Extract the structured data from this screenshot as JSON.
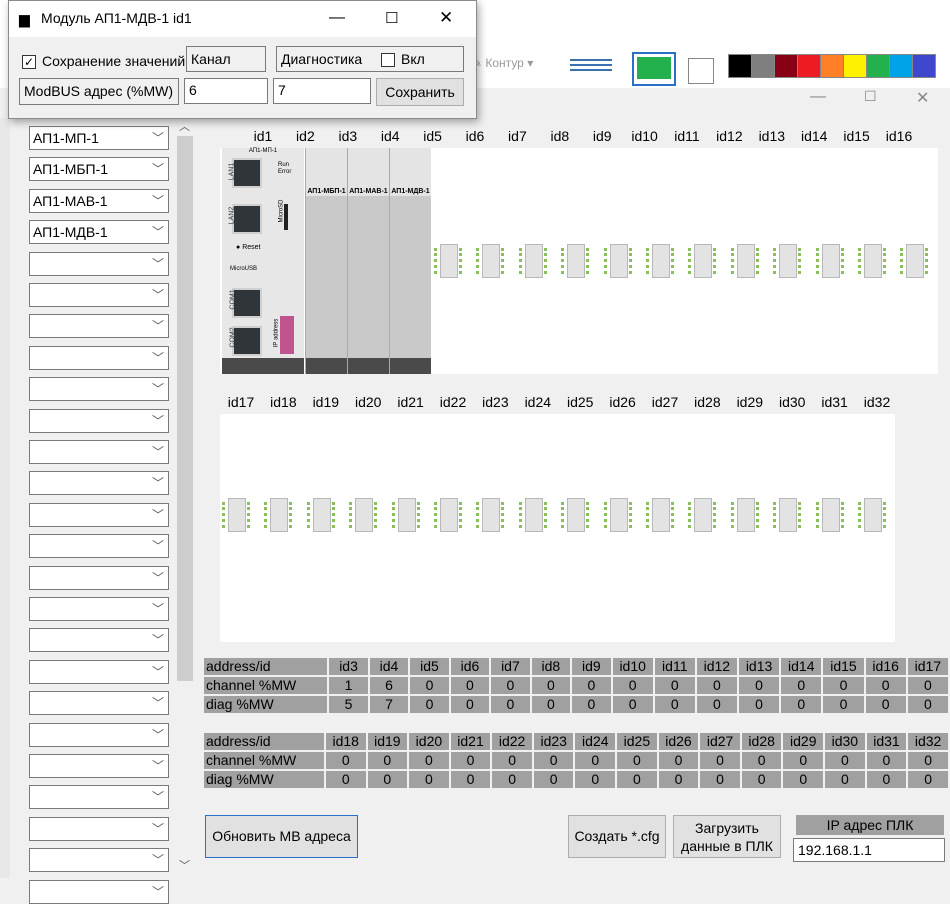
{
  "dialog": {
    "title": "Модуль АП1-МДВ-1 id1",
    "save_values_label": "Сохранение значений",
    "save_values_checked": true,
    "channel_label": "Канал",
    "diag_label": "Диагностика",
    "enable_label": "Вкл",
    "enable_checked": false,
    "modbus_label": "ModBUS адрес (%MW)",
    "channel_value": "6",
    "diag_value": "7",
    "save_button": "Сохранить"
  },
  "toolbar": {
    "contour_label": "Контур",
    "colors": [
      "#000000",
      "#7f7f7f",
      "#880015",
      "#ed1c24",
      "#ff7f27",
      "#fff200",
      "#22b14c",
      "#00a2e8",
      "#3f48cc"
    ]
  },
  "modules": [
    "АП1-МП-1",
    "АП1-МБП-1",
    "АП1-МАВ-1",
    "АП1-МДВ-1",
    "",
    "",
    "",
    "",
    "",
    "",
    "",
    "",
    "",
    "",
    "",
    "",
    "",
    "",
    "",
    "",
    "",
    "",
    "",
    "",
    ""
  ],
  "rack1_ids": [
    "id1",
    "id2",
    "id3",
    "id4",
    "id5",
    "id6",
    "id7",
    "id8",
    "id9",
    "id10",
    "id11",
    "id12",
    "id13",
    "id14",
    "id15",
    "id16"
  ],
  "rack2_ids": [
    "id17",
    "id18",
    "id19",
    "id20",
    "id21",
    "id22",
    "id23",
    "id24",
    "id25",
    "id26",
    "id27",
    "id28",
    "id29",
    "id30",
    "id31",
    "id32"
  ],
  "rack_labels": {
    "mp_top": "АП1-МП-1",
    "lan1": "LAN1",
    "lan2": "LAN2",
    "reset": "Reset",
    "microusb": "MicroUSB",
    "microsd": "MicroSD",
    "com1": "COM1",
    "com2": "COM2",
    "ip": "IP address",
    "run": "Run",
    "error": "Error",
    "mod2": "АП1-МБП-1",
    "mod3": "АП1-МАВ-1",
    "mod4": "АП1-МДВ-1"
  },
  "table1": {
    "header": [
      "address/id",
      "id3",
      "id4",
      "id5",
      "id6",
      "id7",
      "id8",
      "id9",
      "id10",
      "id11",
      "id12",
      "id13",
      "id14",
      "id15",
      "id16",
      "id17"
    ],
    "rows": [
      [
        "channel %MW",
        "1",
        "6",
        "0",
        "0",
        "0",
        "0",
        "0",
        "0",
        "0",
        "0",
        "0",
        "0",
        "0",
        "0",
        "0"
      ],
      [
        "diag %MW",
        "5",
        "7",
        "0",
        "0",
        "0",
        "0",
        "0",
        "0",
        "0",
        "0",
        "0",
        "0",
        "0",
        "0",
        "0"
      ]
    ]
  },
  "table2": {
    "header": [
      "address/id",
      "id18",
      "id19",
      "id20",
      "id21",
      "id22",
      "id23",
      "id24",
      "id25",
      "id26",
      "id27",
      "id28",
      "id29",
      "id30",
      "id31",
      "id32"
    ],
    "rows": [
      [
        "channel %MW",
        "0",
        "0",
        "0",
        "0",
        "0",
        "0",
        "0",
        "0",
        "0",
        "0",
        "0",
        "0",
        "0",
        "0",
        "0"
      ],
      [
        "diag %MW",
        "0",
        "0",
        "0",
        "0",
        "0",
        "0",
        "0",
        "0",
        "0",
        "0",
        "0",
        "0",
        "0",
        "0",
        "0"
      ]
    ]
  },
  "buttons": {
    "update_mb": "Обновить МВ адреса",
    "create_cfg": "Создать *.cfg",
    "upload": "Загрузить данные в ПЛК"
  },
  "plc": {
    "ip_label": "IP адрес ПЛК",
    "ip_value": "192.168.1.1"
  }
}
